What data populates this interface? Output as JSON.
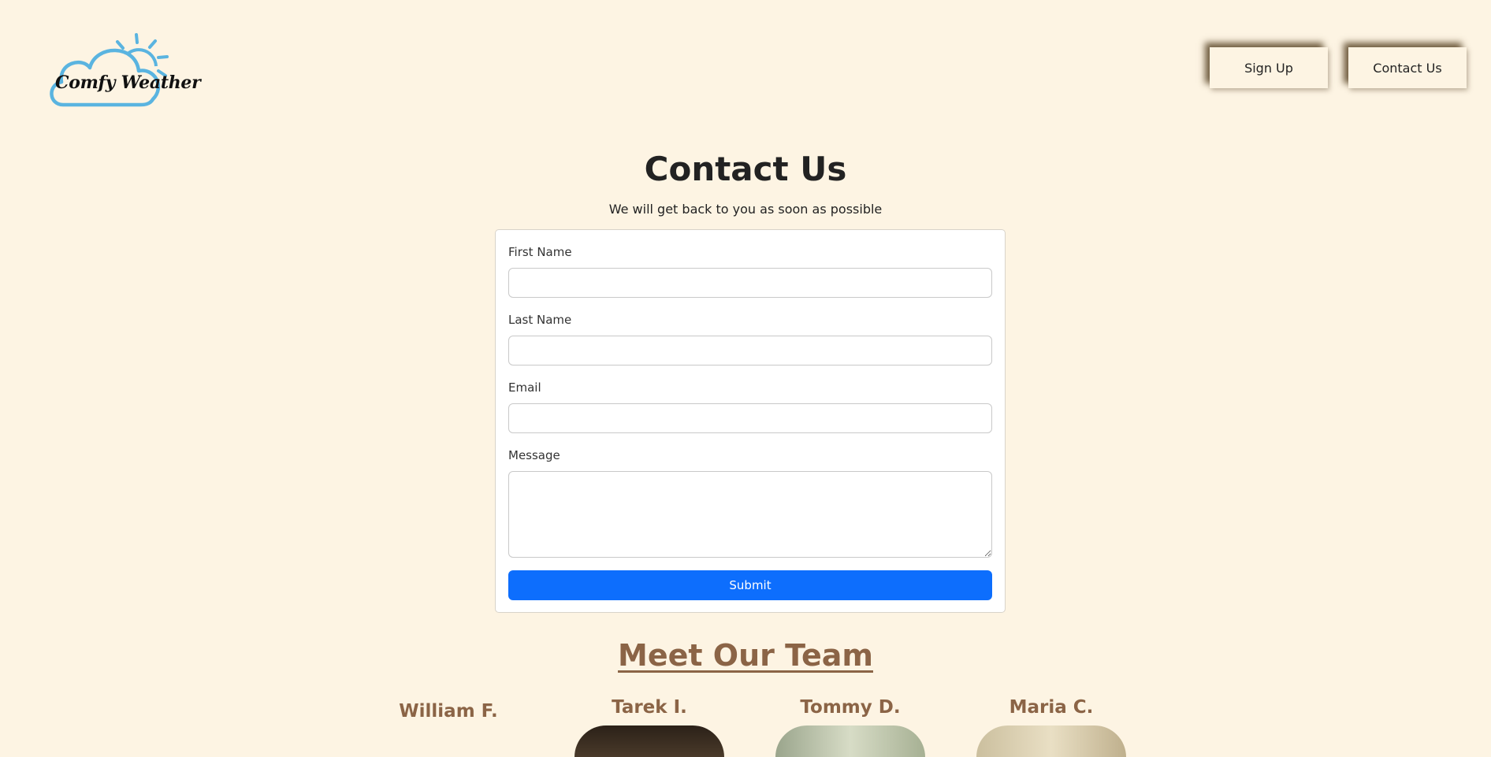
{
  "header": {
    "logo_text": "Comfy Weather",
    "nav": {
      "signup_label": "Sign Up",
      "contact_label": "Contact Us"
    }
  },
  "contact": {
    "title": "Contact Us",
    "subtitle": "We will get back to you as soon as possible",
    "fields": {
      "first_name": {
        "label": "First Name",
        "value": "",
        "placeholder": ""
      },
      "last_name": {
        "label": "Last Name",
        "value": "",
        "placeholder": ""
      },
      "email": {
        "label": "Email",
        "value": "",
        "placeholder": ""
      },
      "message": {
        "label": "Message",
        "value": "",
        "placeholder": ""
      }
    },
    "submit_label": "Submit"
  },
  "team": {
    "heading": "Meet Our Team",
    "members": [
      {
        "name": "William F."
      },
      {
        "name": "Tarek I."
      },
      {
        "name": "Tommy D."
      },
      {
        "name": "Maria C."
      }
    ]
  },
  "colors": {
    "background": "#fdf4e3",
    "logo_blue": "#5ab4e0",
    "submit_blue": "#0d6efd",
    "team_brown": "#8b6446"
  },
  "icons": {
    "logo": "cloud-sun-icon"
  }
}
